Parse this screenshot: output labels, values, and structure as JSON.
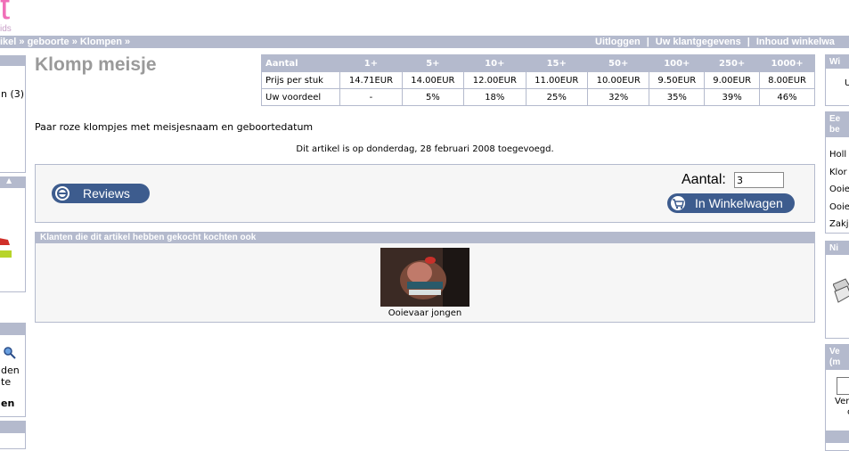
{
  "header": {
    "logo_text": "t",
    "logo_sub": "ids",
    "breadcrumb": "ikel » geboorte » Klompen »",
    "nav_links": [
      "Uitloggen",
      "Uw klantgegevens",
      "Inhoud winkelwa"
    ]
  },
  "left_sidebar": {
    "cat_item": "n (3)",
    "search_lines": [
      "den",
      "te"
    ],
    "search_bold": "en"
  },
  "product": {
    "title": "Klomp meisje",
    "description": "Paar roze klompjes met meisjesnaam en geboortedatum",
    "added_text": "Dit artikel is op donderdag, 28 februari 2008 toegevoegd."
  },
  "price_table": {
    "headers": [
      "Aantal",
      "1+",
      "5+",
      "10+",
      "15+",
      "50+",
      "100+",
      "250+",
      "1000+"
    ],
    "rows": [
      [
        "Prijs per stuk",
        "14.71EUR",
        "14.00EUR",
        "12.00EUR",
        "11.00EUR",
        "10.00EUR",
        "9.50EUR",
        "9.00EUR",
        "8.00EUR"
      ],
      [
        "Uw voordeel",
        "-",
        "5%",
        "18%",
        "25%",
        "32%",
        "35%",
        "39%",
        "46%"
      ]
    ]
  },
  "actions": {
    "reviews_label": "Reviews",
    "qty_label": "Aantal:",
    "qty_value": "3",
    "cart_label": "In Winkelwagen"
  },
  "also_bought": {
    "header": "Klanten die dit artikel hebben gekocht kochten ook",
    "items": [
      {
        "name": "Ooievaar jongen"
      }
    ]
  },
  "right_sidebar": {
    "box1_head": "Wi",
    "box1_text": "U",
    "box2_head": [
      "Ee",
      "be"
    ],
    "box2_items": [
      "Holl",
      "Klor",
      "Ooie",
      "Ooie",
      "Zakj"
    ],
    "box3_head": "Ni",
    "box4_head": [
      "Ve",
      "(m"
    ],
    "box4_text": [
      "Ver",
      "c"
    ]
  },
  "colors": {
    "bar": "#b4bacd",
    "button": "#3d5c8e",
    "logo": "#f06fb8",
    "title": "#9a9a9a"
  }
}
